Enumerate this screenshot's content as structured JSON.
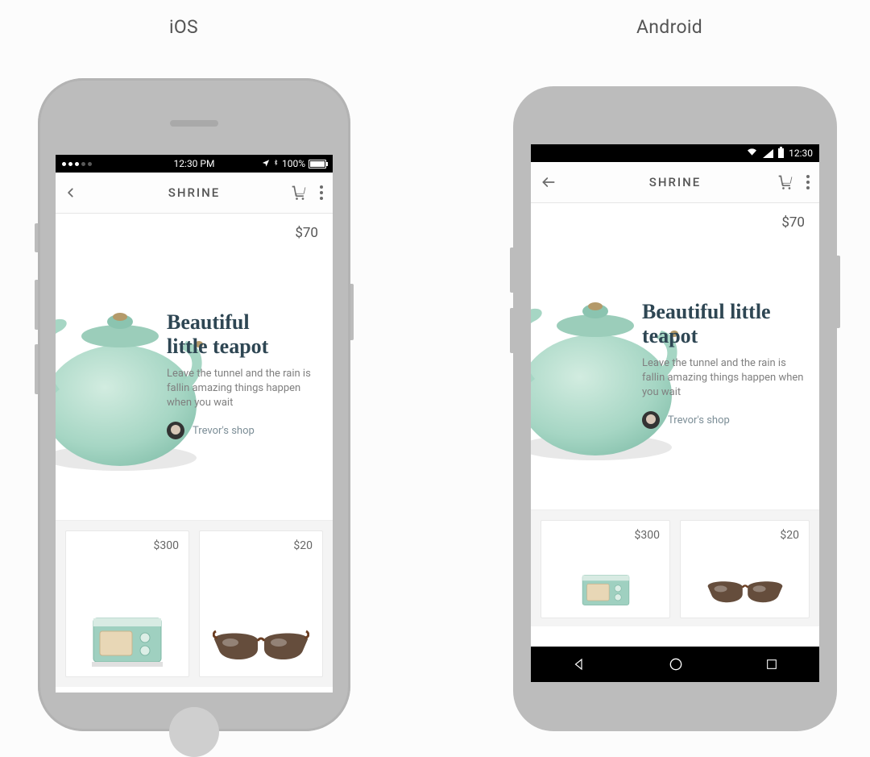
{
  "labels": {
    "ios": "iOS",
    "android": "Android"
  },
  "ios_status": {
    "time": "12:30 PM",
    "battery_pct": "100%"
  },
  "android_status": {
    "time": "12:30"
  },
  "appbar": {
    "title": "SHRINE"
  },
  "hero": {
    "price": "$70",
    "title_line1": "Beautiful little",
    "title_line2": "teapot",
    "title_line2_alt": "little teapot",
    "title_line1_alt": "Beautiful",
    "subtitle": "Leave the tunnel and the rain is fallin amazing things happen when you wait",
    "vendor": "Trevor's shop"
  },
  "products": [
    {
      "price": "$300"
    },
    {
      "price": "$20"
    }
  ]
}
